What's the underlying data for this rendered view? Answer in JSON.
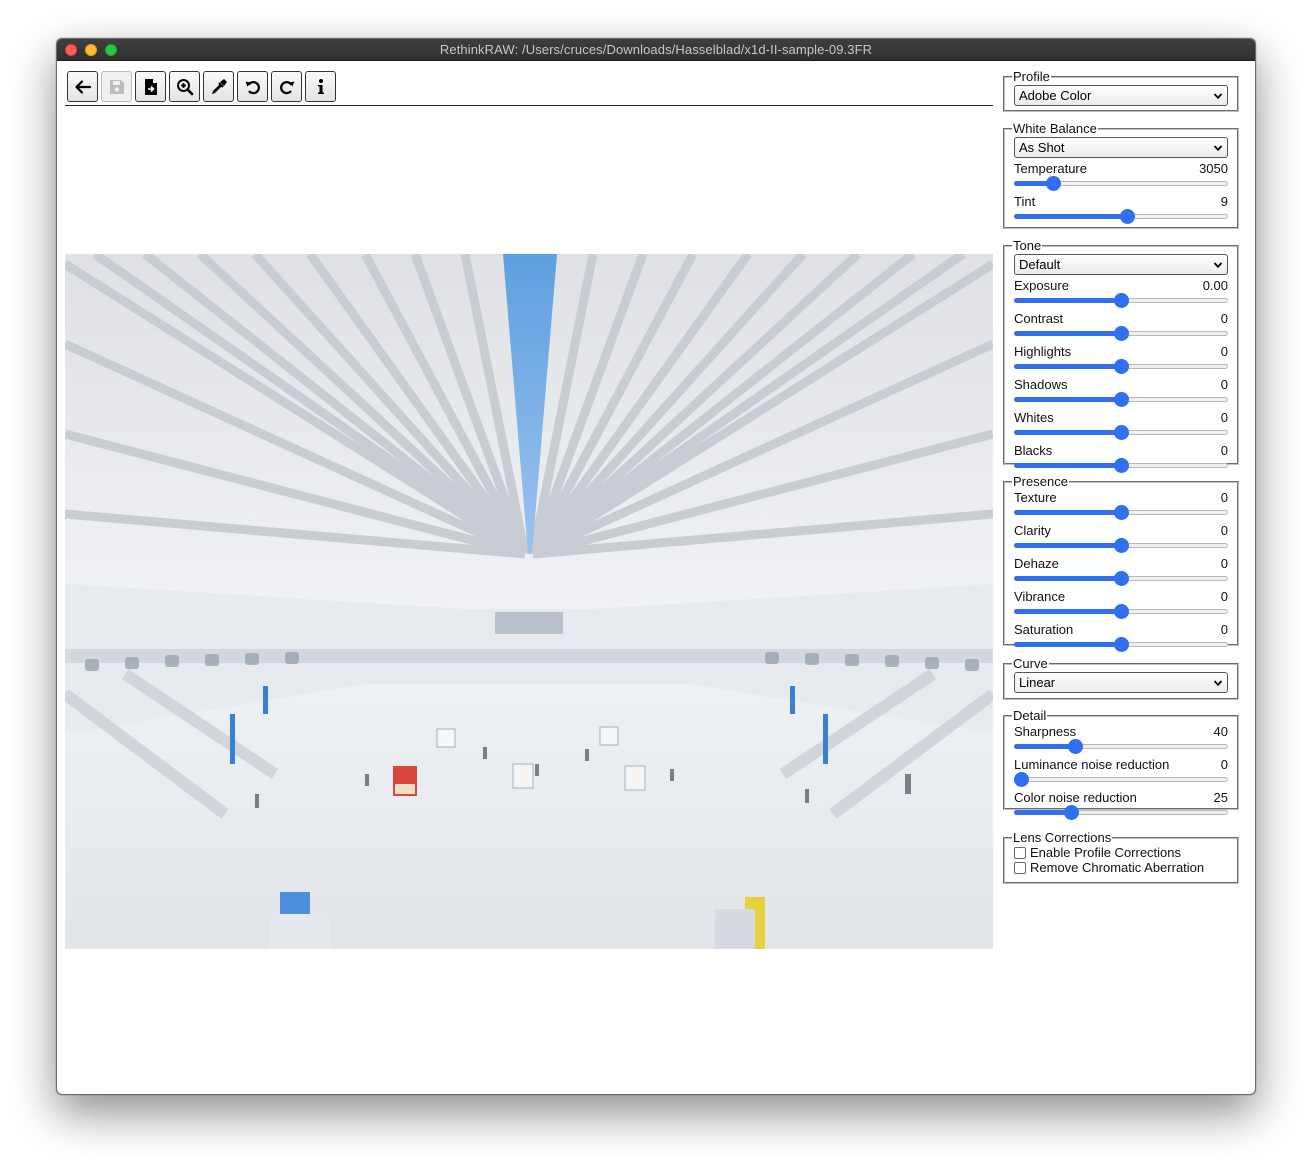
{
  "window": {
    "title": "RethinkRAW: /Users/cruces/Downloads/Hasselblad/x1d-II-sample-09.3FR"
  },
  "toolbar": {
    "buttons": [
      {
        "name": "back",
        "icon": "arrow-left-icon",
        "enabled": true
      },
      {
        "name": "save",
        "icon": "save-icon",
        "enabled": false
      },
      {
        "name": "export",
        "icon": "file-export-icon",
        "enabled": true
      },
      {
        "name": "zoom",
        "icon": "zoom-in-icon",
        "enabled": true
      },
      {
        "name": "white-balance-picker",
        "icon": "eyedropper-icon",
        "enabled": true
      },
      {
        "name": "rotate-left",
        "icon": "rotate-left-icon",
        "enabled": true
      },
      {
        "name": "rotate-right",
        "icon": "rotate-right-icon",
        "enabled": true
      },
      {
        "name": "info",
        "icon": "info-icon",
        "enabled": true
      }
    ]
  },
  "image": {
    "description_icon": "photo-preview"
  },
  "panel": {
    "profile": {
      "legend": "Profile",
      "value": "Adobe Color"
    },
    "white_balance": {
      "legend": "White Balance",
      "value": "As Shot",
      "temperature": {
        "label": "Temperature",
        "value": "3050",
        "level": 0.16
      },
      "tint": {
        "label": "Tint",
        "value": "9",
        "level": 0.53
      }
    },
    "tone": {
      "legend": "Tone",
      "value": "Default",
      "exposure": {
        "label": "Exposure",
        "value": "0.00",
        "level": 0.5
      },
      "contrast": {
        "label": "Contrast",
        "value": "0",
        "level": 0.5
      },
      "highlights": {
        "label": "Highlights",
        "value": "0",
        "level": 0.5
      },
      "shadows": {
        "label": "Shadows",
        "value": "0",
        "level": 0.5
      },
      "whites": {
        "label": "Whites",
        "value": "0",
        "level": 0.5
      },
      "blacks": {
        "label": "Blacks",
        "value": "0",
        "level": 0.5
      }
    },
    "presence": {
      "legend": "Presence",
      "texture": {
        "label": "Texture",
        "value": "0",
        "level": 0.5
      },
      "clarity": {
        "label": "Clarity",
        "value": "0",
        "level": 0.5
      },
      "dehaze": {
        "label": "Dehaze",
        "value": "0",
        "level": 0.5
      },
      "vibrance": {
        "label": "Vibrance",
        "value": "0",
        "level": 0.5
      },
      "saturation": {
        "label": "Saturation",
        "value": "0",
        "level": 0.5
      }
    },
    "curve": {
      "legend": "Curve",
      "value": "Linear"
    },
    "detail": {
      "legend": "Detail",
      "sharpness": {
        "label": "Sharpness",
        "value": "40",
        "level": 0.27
      },
      "luminance_nr": {
        "label": "Luminance noise reduction",
        "value": "0",
        "level": 0.0
      },
      "color_nr": {
        "label": "Color noise reduction",
        "value": "25",
        "level": 0.25
      }
    },
    "lens": {
      "legend": "Lens Corrections",
      "enable_profile": {
        "label": "Enable Profile Corrections",
        "checked": false
      },
      "remove_ca": {
        "label": "Remove Chromatic Aberration",
        "checked": false
      }
    }
  },
  "colors": {
    "accent": "#2f6ff0",
    "titlebar": "#353535"
  }
}
